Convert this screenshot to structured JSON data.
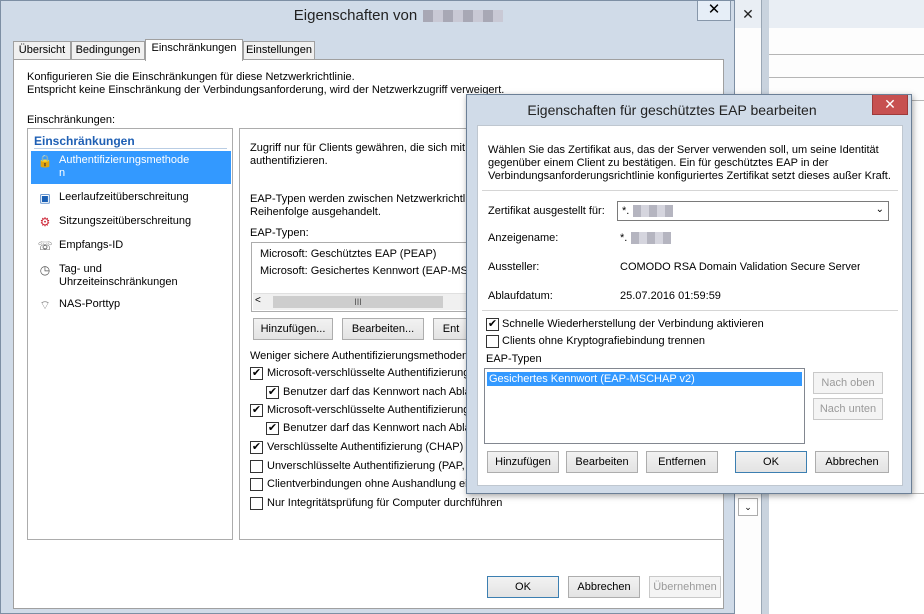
{
  "background_window": {
    "close_label": "✕",
    "combo_arrow": "⌄"
  },
  "main_dialog": {
    "title": "Eigenschaften von",
    "close_label": "✕",
    "tabs": [
      {
        "label": "Übersicht"
      },
      {
        "label": "Bedingungen"
      },
      {
        "label": "Einschränkungen"
      },
      {
        "label": "Einstellungen"
      }
    ],
    "description_line1": "Konfigurieren Sie die Einschränkungen für diese Netzwerkrichtlinie.",
    "description_line2": "Entspricht keine Einschränkung der Verbindungsanforderung, wird der Netzwerkzugriff verweigert.",
    "restrictions_label": "Einschränkungen:",
    "nav": {
      "header": "Einschränkungen",
      "items": [
        {
          "label_line1": "Authentifizierungsmethode",
          "label_line2": "n",
          "icon": "lock-icon"
        },
        {
          "label_line1": "Leerlaufzeitüberschreitung",
          "icon": "idle-timeout-icon"
        },
        {
          "label_line1": "Sitzungszeitüberschreitung",
          "icon": "session-timeout-icon"
        },
        {
          "label_line1": "Empfangs-ID",
          "icon": "called-station-icon"
        },
        {
          "label_line1": "Tag- und",
          "label_line2": "Uhrzeiteinschränkungen",
          "icon": "clock-icon"
        },
        {
          "label_line1": "NAS-Porttyp",
          "icon": "nas-port-icon"
        }
      ]
    },
    "panel": {
      "intro_line1": "Zugriff nur für Clients gewähren, die sich mit de",
      "intro_line2": "authentifizieren.",
      "eap_info_line1": "EAP-Typen werden zwischen Netzwerkrichtlini",
      "eap_info_line2": "Reihenfolge ausgehandelt.",
      "eap_types_label": "EAP-Typen:",
      "eap_list": [
        "Microsoft: Geschütztes EAP (PEAP)",
        "Microsoft: Gesichertes Kennwort (EAP-MSCHA"
      ],
      "scroll_grip": "III",
      "scroll_left": "<",
      "add_button": "Hinzufügen...",
      "edit_button": "Bearbeiten...",
      "remove_button": "Ent",
      "less_secure_label": "Weniger sichere Authentifizierungsmethoden:",
      "checkboxes": [
        {
          "label": "Microsoft-verschlüsselte Authentifizierung, V",
          "checked": true
        },
        {
          "label": "Benutzer darf das Kennwort nach Ablau",
          "checked": true
        },
        {
          "label": "Microsoft-verschlüsselte Authentifizierung (",
          "checked": true
        },
        {
          "label": "Benutzer darf das Kennwort nach Ablau",
          "checked": true
        },
        {
          "label": "Verschlüsselte Authentifizierung (CHAP)",
          "checked": true
        },
        {
          "label": "Unverschlüsselte Authentifizierung (PAP, S",
          "checked": false
        },
        {
          "label": "Clientverbindungen ohne Aushandlung eine",
          "checked": false
        },
        {
          "label": "Nur Integritätsprüfung für Computer durchführen",
          "checked": false
        }
      ]
    },
    "ok_button": "OK",
    "cancel_button": "Abbrechen",
    "apply_button": "Übernehmen"
  },
  "eap_dialog": {
    "title": "Eigenschaften für geschütztes EAP bearbeiten",
    "close_label": "✕",
    "description": "Wählen Sie das Zertifikat aus, das der Server verwenden soll, um seine Identität gegenüber einem Client zu bestätigen. Ein für geschütztes EAP in der Verbindungsanforderungsrichtlinie konfiguriertes Zertifikat setzt dieses außer Kraft.",
    "cert_label": "Zertifikat ausgestellt für:",
    "cert_value": "*.",
    "display_name_label": "Anzeigename:",
    "display_name_value": "*.",
    "issuer_label": "Aussteller:",
    "issuer_value": "COMODO RSA Domain Validation Secure Server CA",
    "expiry_label": "Ablaufdatum:",
    "expiry_value": "25.07.2016 01:59:59",
    "fast_reconnect_label": "Schnelle Wiederherstellung der Verbindung aktivieren",
    "fast_reconnect_checked": true,
    "disconnect_label": "Clients ohne Kryptografiebindung trennen",
    "disconnect_checked": false,
    "eap_types_label": "EAP-Typen",
    "eap_types": [
      "Gesichertes Kennwort (EAP-MSCHAP v2)"
    ],
    "move_up_button": "Nach oben",
    "move_down_button": "Nach unten",
    "add_button": "Hinzufügen",
    "edit_button": "Bearbeiten",
    "remove_button": "Entfernen",
    "ok_button": "OK",
    "cancel_button": "Abbrechen"
  }
}
